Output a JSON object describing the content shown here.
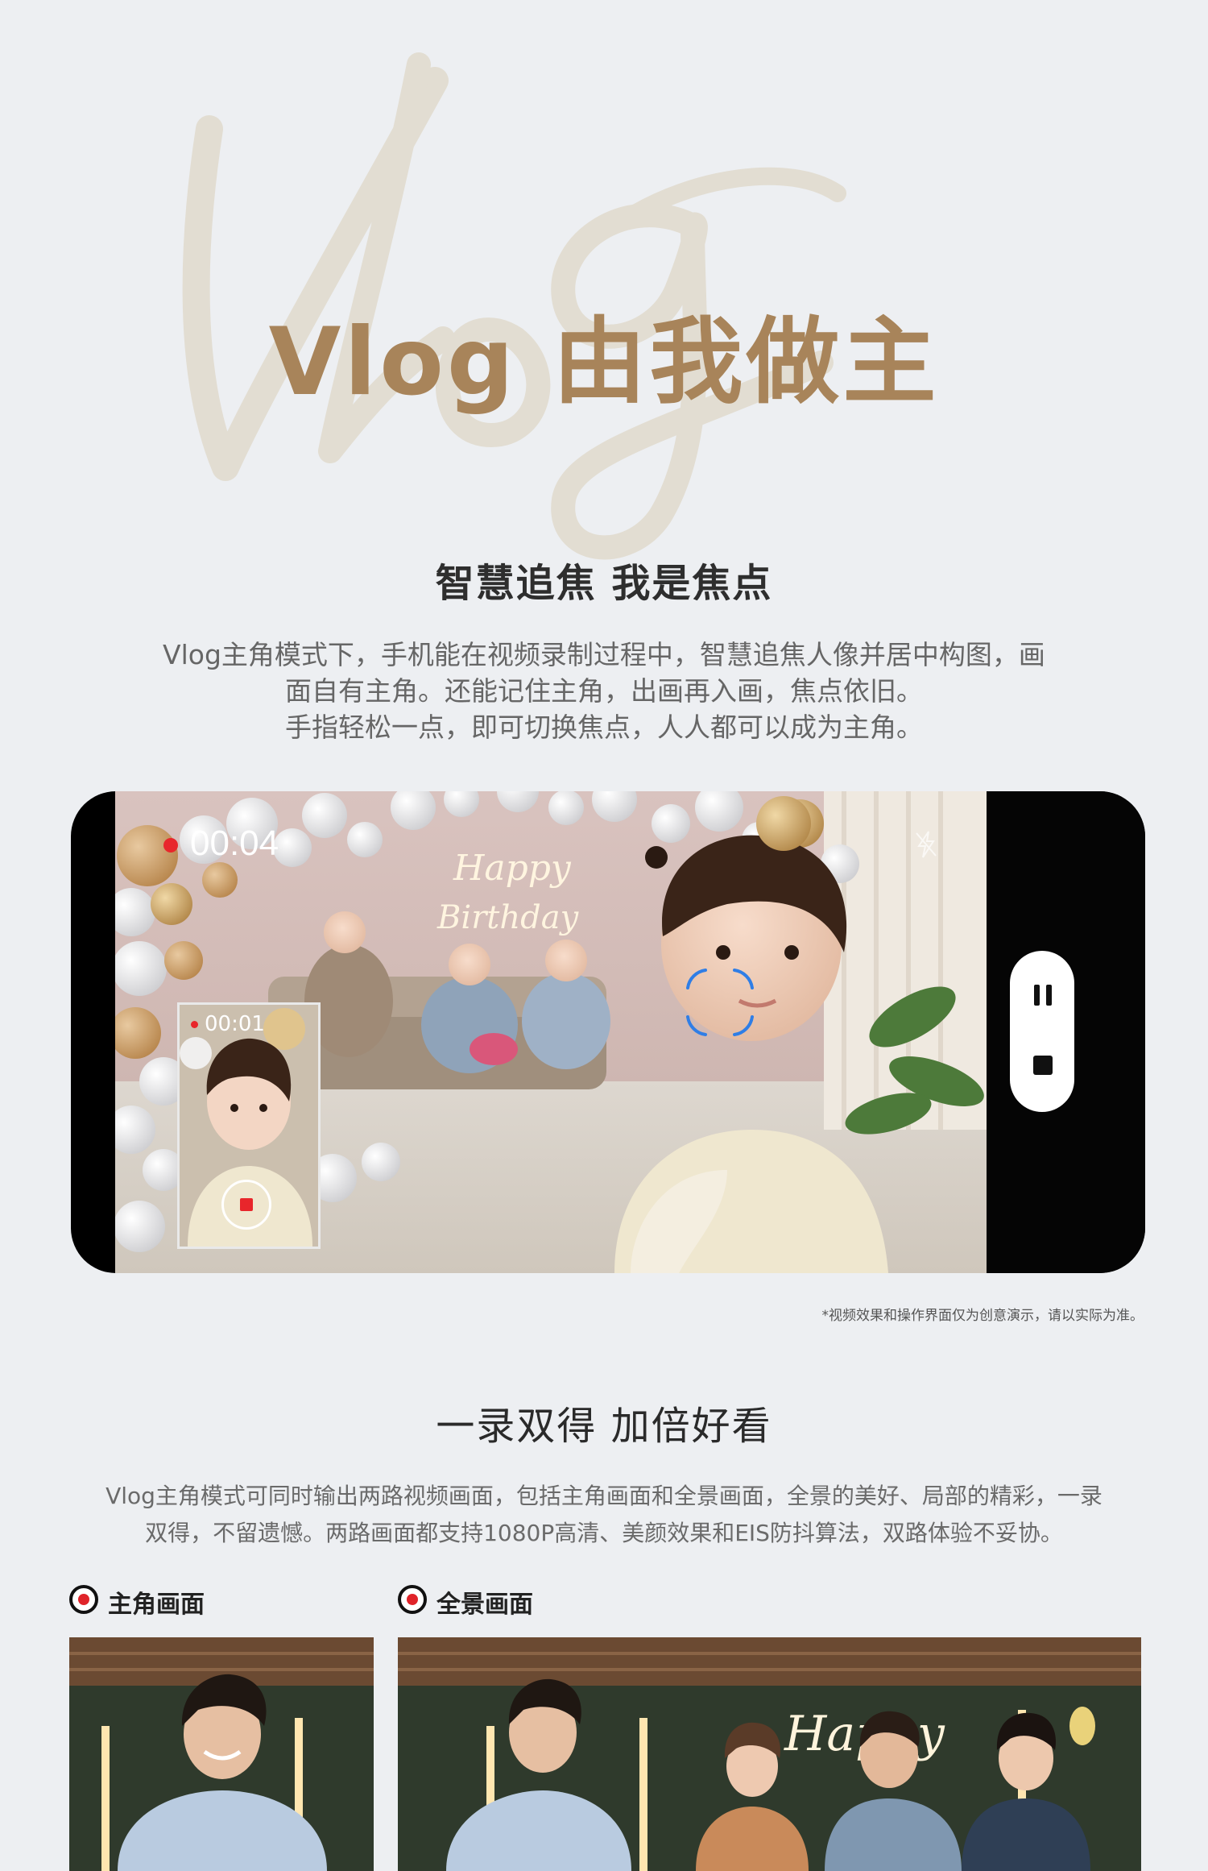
{
  "hero": {
    "script_watermark": "Vlog",
    "title": "Vlog 由我做主"
  },
  "section1": {
    "title": "智慧追焦 我是焦点",
    "paragraph_lines": [
      "Vlog主角模式下，手机能在视频录制过程中，智慧追焦人像并居中构图，画",
      "面自有主角。还能记住主角，出画再入画，焦点依旧。",
      "手指轻松一点，即可切换焦点，人人都可以成为主角。"
    ]
  },
  "phone_demo": {
    "recording_time": "00:04",
    "pip_time": "00:01",
    "neon_sign_line1": "Happy",
    "neon_sign_line2": "Birthday",
    "icons": [
      "record-dot-icon",
      "flash-off-icon",
      "focus-frame-icon",
      "pause-icon",
      "stop-icon",
      "pip-record-icon"
    ],
    "colors": {
      "record_red": "#e8262b",
      "focus_blue": "#2f7ee6"
    }
  },
  "disclaimer": "*视频效果和操作界面仅为创意演示，请以实际为准。",
  "section2": {
    "title": "一录双得 加倍好看",
    "paragraph_lines": [
      "Vlog主角模式可同时输出两路视频画面，包括主角画面和全景画面，全景的美好、局部的精彩，一录",
      "双得，不留遗憾。两路画面都支持1080P高清、美颜效果和EIS防抖算法，双路体验不妥协。"
    ],
    "tabs": [
      {
        "label": "主角画面"
      },
      {
        "label": "全景画面"
      }
    ],
    "panorama_sign": "Happy"
  },
  "colors": {
    "title_gold": "#a8845a",
    "background": "#edeff2"
  }
}
